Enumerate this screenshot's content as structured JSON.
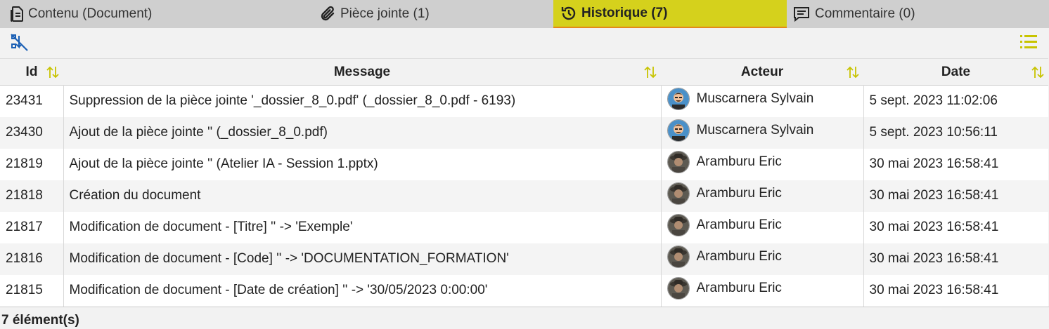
{
  "tabs": [
    {
      "label": "Contenu (Document)",
      "icon": "document-icon"
    },
    {
      "label": "Pièce jointe (1)",
      "icon": "paperclip-icon"
    },
    {
      "label": "Historique (7)",
      "icon": "history-icon"
    },
    {
      "label": "Commentaire (0)",
      "icon": "comment-icon"
    }
  ],
  "toolbar": {
    "left_icon": "filter-off-icon",
    "right_icon": "list-icon"
  },
  "colors": {
    "active_tab": "#d5d11c",
    "accent": "#c8c400",
    "active_border": "#e4891a"
  },
  "table": {
    "headers": {
      "id": "Id",
      "message": "Message",
      "actor": "Acteur",
      "date": "Date"
    },
    "rows": [
      {
        "id": "23431",
        "message": "Suppression de la pièce jointe '_dossier_8_0.pdf' (_dossier_8_0.pdf - 6193)",
        "actor": "Muscarnera Sylvain",
        "avatar": "cartoon",
        "date": "5 sept. 2023 11:02:06"
      },
      {
        "id": "23430",
        "message": "Ajout de la pièce jointe '' (_dossier_8_0.pdf)",
        "actor": "Muscarnera Sylvain",
        "avatar": "cartoon",
        "date": "5 sept. 2023 10:56:11"
      },
      {
        "id": "21819",
        "message": "Ajout de la pièce jointe '' (Atelier IA - Session 1.pptx)",
        "actor": "Aramburu Eric",
        "avatar": "photo",
        "date": "30 mai 2023 16:58:41"
      },
      {
        "id": "21818",
        "message": "Création du document",
        "actor": "Aramburu Eric",
        "avatar": "photo",
        "date": "30 mai 2023 16:58:41"
      },
      {
        "id": "21817",
        "message": "Modification de document - [Titre] '' -> 'Exemple'",
        "actor": "Aramburu Eric",
        "avatar": "photo",
        "date": "30 mai 2023 16:58:41"
      },
      {
        "id": "21816",
        "message": "Modification de document - [Code] '' -> 'DOCUMENTATION_FORMATION'",
        "actor": "Aramburu Eric",
        "avatar": "photo",
        "date": "30 mai 2023 16:58:41"
      },
      {
        "id": "21815",
        "message": "Modification de document - [Date de création] '' -> '30/05/2023 0:00:00'",
        "actor": "Aramburu Eric",
        "avatar": "photo",
        "date": "30 mai 2023 16:58:41"
      }
    ]
  },
  "footer": {
    "count": "7 élément(s)"
  }
}
